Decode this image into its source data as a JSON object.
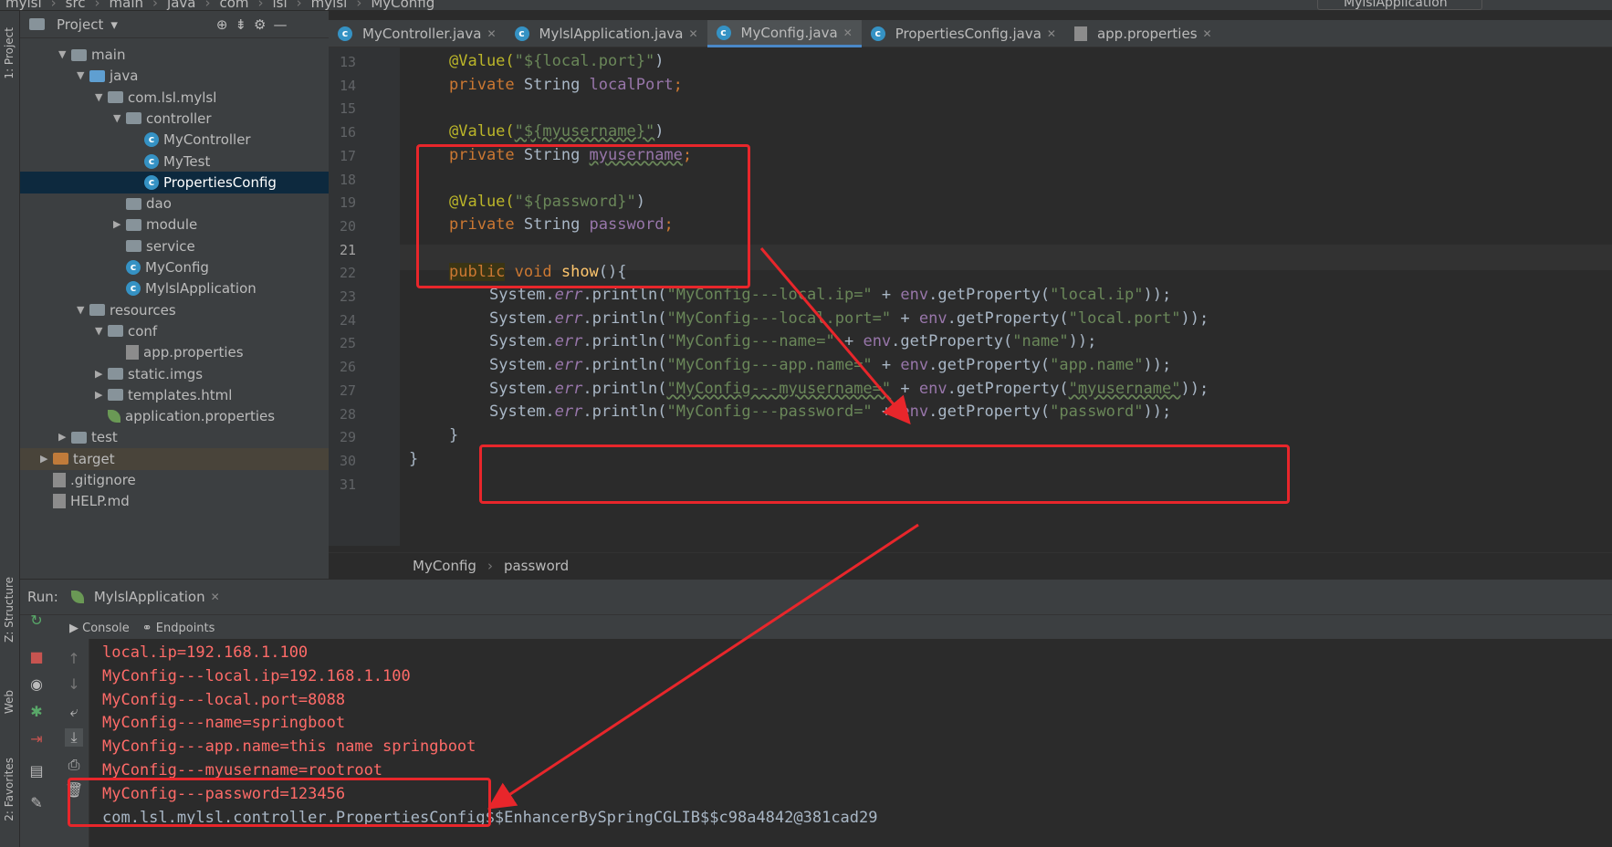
{
  "navbar": {
    "crumbs": [
      "mylsl",
      "src",
      "main",
      "java",
      "com",
      "lsl",
      "mylsl",
      "MyConfig"
    ],
    "run_config": "MylslApplication"
  },
  "side_labels": {
    "project": "1: Project",
    "structure": "Z: Structure",
    "web": "Web",
    "favorites": "2: Favorites"
  },
  "project": {
    "title": "Project",
    "tree": [
      {
        "label": "main",
        "kind": "folder"
      },
      {
        "label": "java",
        "kind": "folder-blue"
      },
      {
        "label": "com.lsl.mylsl",
        "kind": "folder"
      },
      {
        "label": "controller",
        "kind": "folder"
      },
      {
        "label": "MyController",
        "kind": "class"
      },
      {
        "label": "MyTest",
        "kind": "class"
      },
      {
        "label": "PropertiesConfig",
        "kind": "class"
      },
      {
        "label": "dao",
        "kind": "folder"
      },
      {
        "label": "module",
        "kind": "folder"
      },
      {
        "label": "service",
        "kind": "folder"
      },
      {
        "label": "MyConfig",
        "kind": "class"
      },
      {
        "label": "MylslApplication",
        "kind": "class"
      },
      {
        "label": "resources",
        "kind": "folder"
      },
      {
        "label": "conf",
        "kind": "folder"
      },
      {
        "label": "app.properties",
        "kind": "file"
      },
      {
        "label": "static.imgs",
        "kind": "folder"
      },
      {
        "label": "templates.html",
        "kind": "folder"
      },
      {
        "label": "application.properties",
        "kind": "leaf"
      },
      {
        "label": "test",
        "kind": "folder"
      },
      {
        "label": "target",
        "kind": "folder-orange"
      },
      {
        "label": ".gitignore",
        "kind": "file"
      },
      {
        "label": "HELP.md",
        "kind": "file"
      }
    ]
  },
  "tabs": [
    "MyController.java",
    "MylslApplication.java",
    "MyConfig.java",
    "PropertiesConfig.java",
    "app.properties"
  ],
  "line_numbers": [
    "13",
    "14",
    "15",
    "16",
    "17",
    "18",
    "19",
    "20",
    "21",
    "22",
    "23",
    "24",
    "25",
    "26",
    "27",
    "28",
    "29",
    "30",
    "31"
  ],
  "code": {
    "l14_ann": "@Value(",
    "l14_str": "\"${local.port}\"",
    "l14_end": ")",
    "l15_kw": "private",
    "l15_type": " String ",
    "l15_fld": "localPort",
    "l15_end": ";",
    "l17_ann": "@Value(",
    "l17_str": "\"${myusername}\"",
    "l17_end": ")",
    "l18_kw": "private",
    "l18_type": " String ",
    "l18_fld": "myusername",
    "l18_end": ";",
    "l20_ann": "@Value(",
    "l20_str": "\"${password}\"",
    "l20_end": ")",
    "l21_kw": "private",
    "l21_type": " String ",
    "l21_fld": "password",
    "l21_end": ";",
    "l23_kw1": "public",
    "l23_kw2": " void ",
    "l23_fn": "show",
    "l23_end": "(){",
    "sys": "System.",
    "err": "err",
    "println": ".println(",
    "plus": " + ",
    "env": "env",
    "getprop": ".getProperty(",
    "close": "));",
    "l24_str": "\"MyConfig---local.ip=\"",
    "l24_key": "\"local.ip\"",
    "l25_str": "\"MyConfig---local.port=\"",
    "l25_key": "\"local.port\"",
    "l26_str": "\"MyConfig---name=\"",
    "l26_key": "\"name\"",
    "l27_str": "\"MyConfig---app.name=\"",
    "l27_key": "\"app.name\"",
    "l28_str": "\"MyConfig---myusername=\"",
    "l28_key": "\"myusername\"",
    "l29_str": "\"MyConfig---password=\"",
    "l29_key": "\"password\"",
    "l30": "}",
    "l31": "}"
  },
  "breadcrumb": {
    "a": "MyConfig",
    "sep": "›",
    "b": "password"
  },
  "run": {
    "label": "Run:",
    "app_tab": "MylslApplication",
    "console_tab": "Console",
    "endpoints_tab": "Endpoints"
  },
  "console_lines": [
    "local.ip=192.168.1.100",
    "MyConfig---local.ip=192.168.1.100",
    "MyConfig---local.port=8088",
    "MyConfig---name=springboot",
    "MyConfig---app.name=this name springboot",
    "MyConfig---myusername=rootroot",
    "MyConfig---password=123456",
    "com.lsl.mylsl.controller.PropertiesConfig$$EnhancerBySpringCGLIB$$c98a4842@381cad29"
  ],
  "colors": {
    "annotation_red": "#e8262b",
    "console_error": "#ff6b68",
    "selection": "#0d293e"
  }
}
